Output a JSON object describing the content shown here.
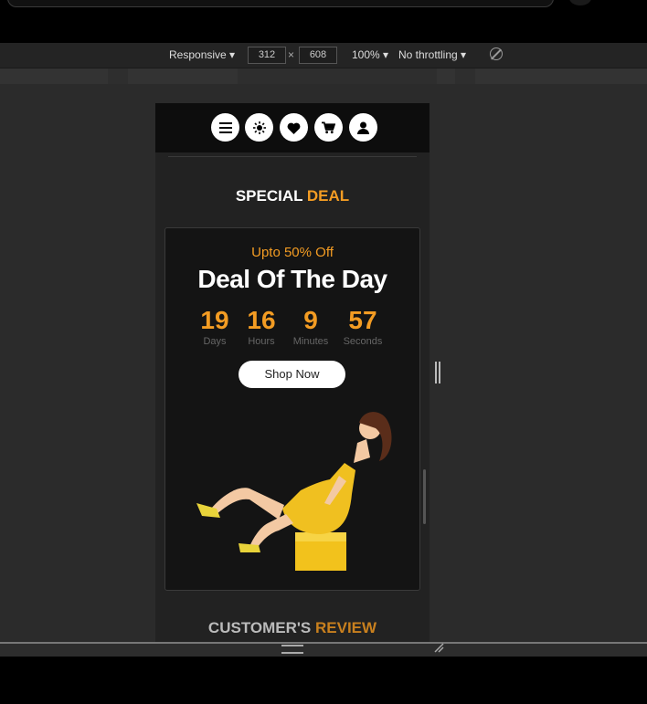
{
  "devtools": {
    "device": "Responsive",
    "width": "312",
    "times": "×",
    "height": "608",
    "zoom": "100%",
    "throttling": "No throttling",
    "rotate_icon": "rotate-icon"
  },
  "nav": {
    "icons": [
      "menu-icon",
      "sun-icon",
      "heart-icon",
      "cart-icon",
      "user-icon"
    ]
  },
  "special": {
    "title_white": "SPECIAL ",
    "title_accent": "DEAL"
  },
  "deal": {
    "upto": "Upto 50% Off",
    "heading": "Deal Of The Day",
    "countdown": [
      {
        "value": "19",
        "label": "Days"
      },
      {
        "value": "16",
        "label": "Hours"
      },
      {
        "value": "9",
        "label": "Minutes"
      },
      {
        "value": "57",
        "label": "Seconds"
      }
    ],
    "button": "Shop Now"
  },
  "review": {
    "title_white": "CUSTOMER'S ",
    "title_accent": "REVIEW"
  },
  "colors": {
    "accent": "#f39c23",
    "background": "#2b2b2b",
    "card": "#141414"
  }
}
